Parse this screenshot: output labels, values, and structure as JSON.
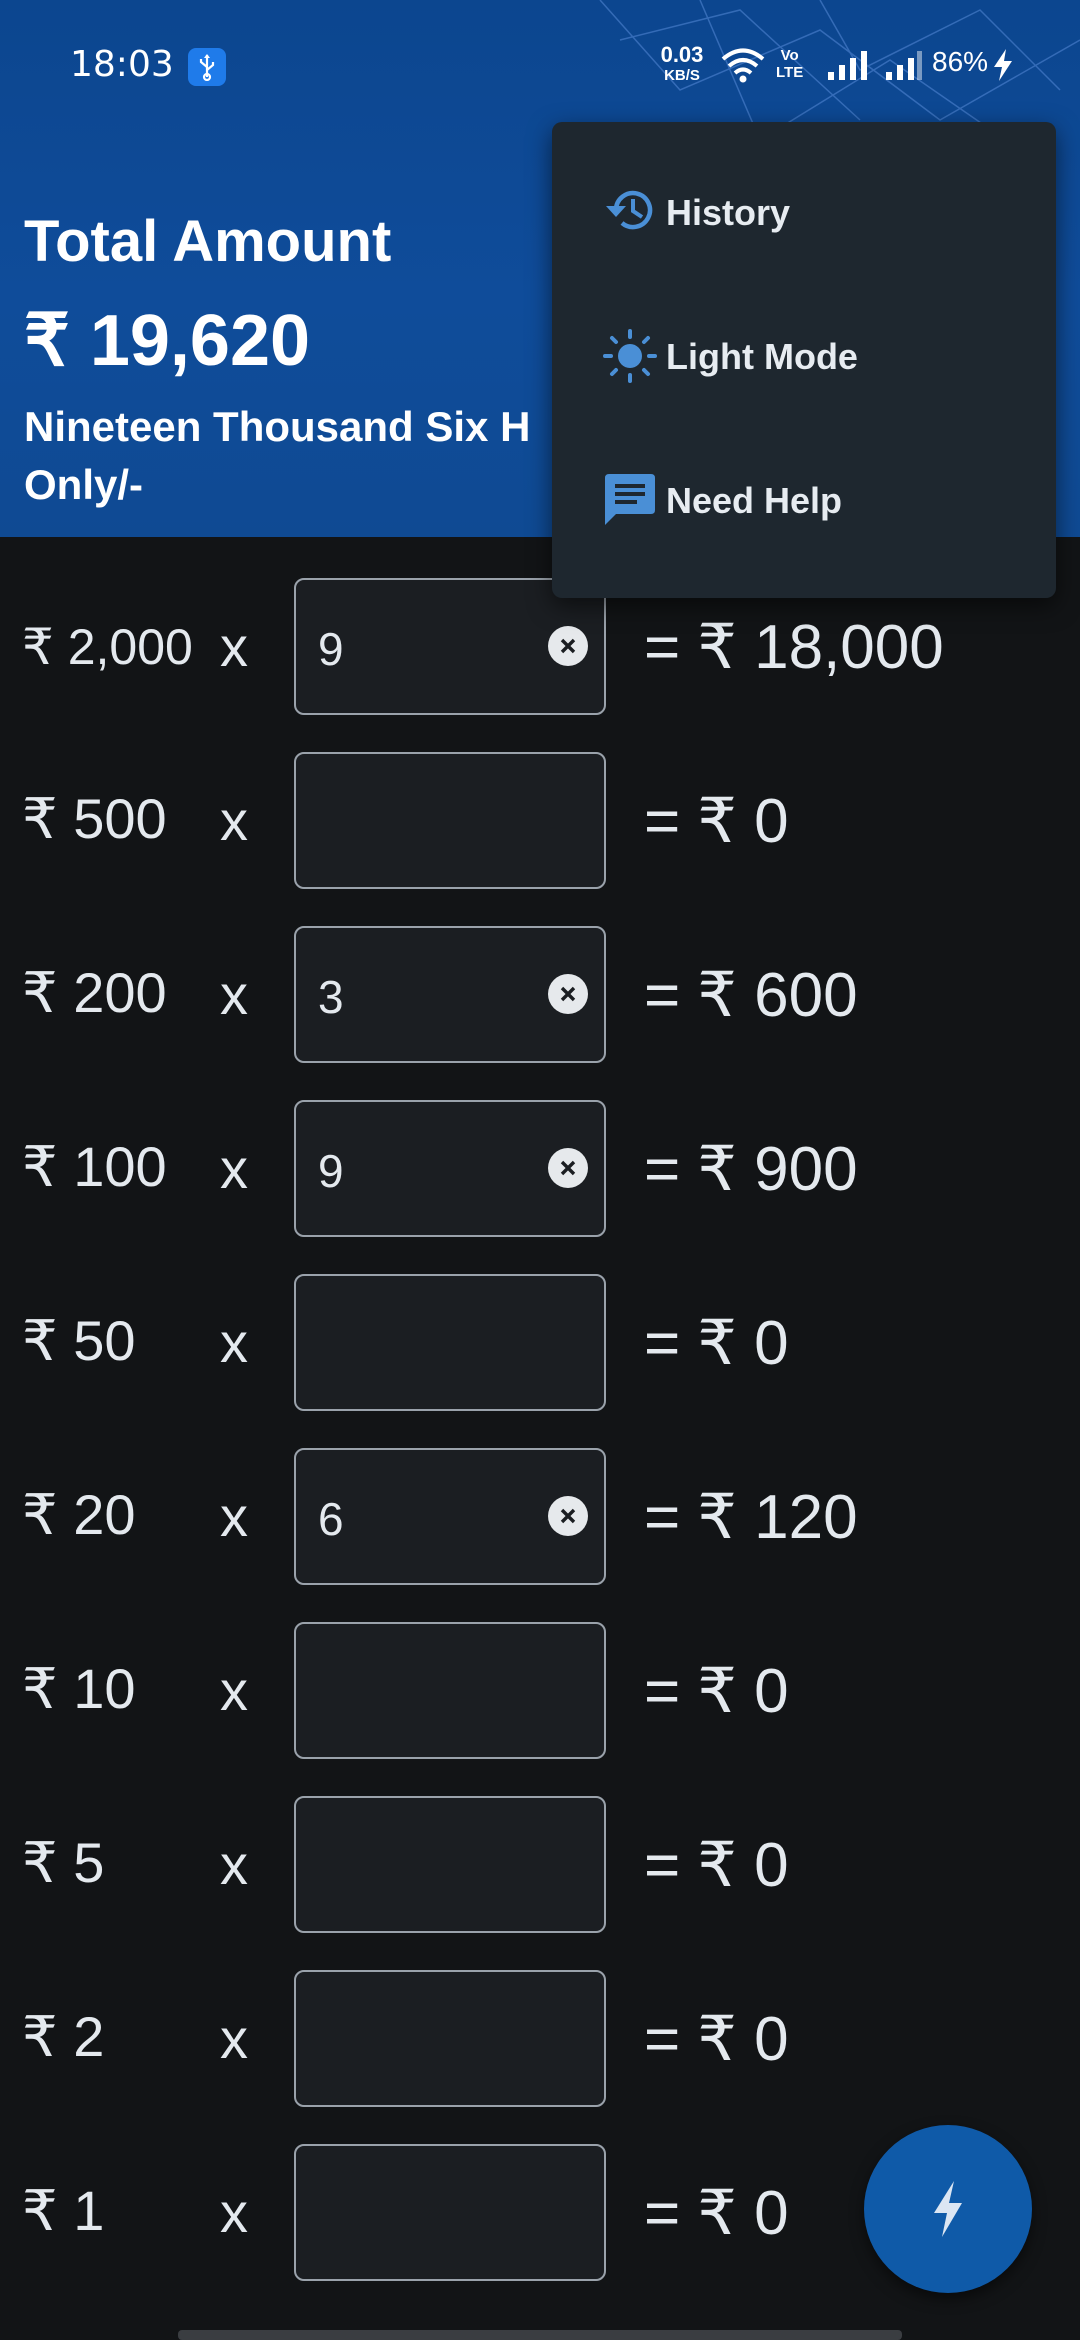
{
  "status_bar": {
    "time": "18:03",
    "net_speed_value": "0.03",
    "net_speed_unit": "KB/S",
    "volte_top": "Vo",
    "volte_bottom": "LTE",
    "battery": "86%"
  },
  "header": {
    "title": "Total Amount",
    "amount": "₹ 19,620",
    "amount_words": "Nineteen Thousand Six H",
    "amount_words_line2": "Only/-",
    "colors": {
      "background": "#0f4a93",
      "text": "#ffffff"
    }
  },
  "rows": [
    {
      "denomination": "₹ 2,000",
      "times": "x",
      "quantity": "9",
      "result": "= ₹ 18,000"
    },
    {
      "denomination": "₹ 500",
      "times": "x",
      "quantity": "",
      "result": "= ₹ 0"
    },
    {
      "denomination": "₹ 200",
      "times": "x",
      "quantity": "3",
      "result": "= ₹ 600"
    },
    {
      "denomination": "₹ 100",
      "times": "x",
      "quantity": "9",
      "result": "= ₹ 900"
    },
    {
      "denomination": "₹ 50",
      "times": "x",
      "quantity": "",
      "result": "= ₹ 0"
    },
    {
      "denomination": "₹ 20",
      "times": "x",
      "quantity": "6",
      "result": "= ₹ 120"
    },
    {
      "denomination": "₹ 10",
      "times": "x",
      "quantity": "",
      "result": "= ₹ 0"
    },
    {
      "denomination": "₹ 5",
      "times": "x",
      "quantity": "",
      "result": "= ₹ 0"
    },
    {
      "denomination": "₹ 2",
      "times": "x",
      "quantity": "",
      "result": "= ₹ 0"
    },
    {
      "denomination": "₹ 1",
      "times": "x",
      "quantity": "",
      "result": "= ₹ 0"
    }
  ],
  "menu": {
    "items": [
      {
        "label": "History",
        "icon": "history-icon"
      },
      {
        "label": "Light Mode",
        "icon": "sun-icon"
      },
      {
        "label": "Need Help",
        "icon": "chat-icon"
      }
    ],
    "colors": {
      "background": "#1e272f",
      "icon": "#4a8fd6"
    }
  },
  "fab": {
    "icon": "bolt-icon",
    "color": "#0f5aa8"
  },
  "colors": {
    "page_background": "#121416",
    "text": "#e4e9ee",
    "accent": "#0f5aa8"
  }
}
